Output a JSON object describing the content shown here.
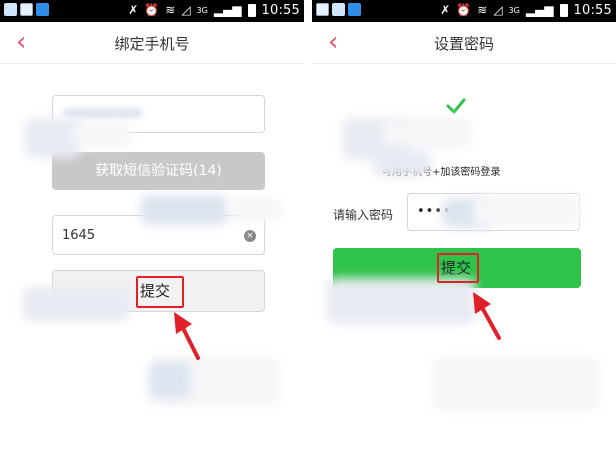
{
  "status_bar": {
    "time": "10:55",
    "network": "3G"
  },
  "left": {
    "title": "绑定手机号",
    "get_code_button": "获取短信验证码(14)",
    "code_value": "1645",
    "submit_button": "提交"
  },
  "right": {
    "title": "设置密码",
    "hint": "可用手机号+加该密码登录",
    "password_label": "请输入密码",
    "password_value": "••••••",
    "submit_button": "提交"
  },
  "colors": {
    "accent_back": "#e05a6e",
    "submit_green": "#2ec34a",
    "highlight_red": "#e0212a",
    "disabled_grey": "#c8c8c8"
  }
}
